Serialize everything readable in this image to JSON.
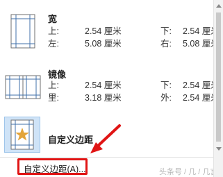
{
  "margins": [
    {
      "name": "宽",
      "rows": [
        {
          "l1": "上:",
          "v1": "2.54 厘米",
          "l2": "下:",
          "v2": "2.54 厘米"
        },
        {
          "l1": "左:",
          "v1": "5.08 厘米",
          "l2": "右:",
          "v2": "5.08 厘米"
        }
      ],
      "icon": "wide-margins-icon"
    },
    {
      "name": "镜像",
      "rows": [
        {
          "l1": "上:",
          "v1": "2.54 厘米",
          "l2": "下:",
          "v2": "2.54 厘米"
        },
        {
          "l1": "里:",
          "v1": "3.18 厘米",
          "l2": "外:",
          "v2": "2.54 厘米"
        }
      ],
      "icon": "mirrored-margins-icon"
    }
  ],
  "custom": {
    "name": "自定义边距",
    "icon": "star-page-icon",
    "link_label": "自定义边距(A)..."
  },
  "watermark": "头条号 / 几 / 几言",
  "colors": {
    "highlight": "#e01414",
    "selected_bg": "#cfe3f7",
    "selected_border": "#9ec5ea",
    "star": "#e3a43a"
  }
}
